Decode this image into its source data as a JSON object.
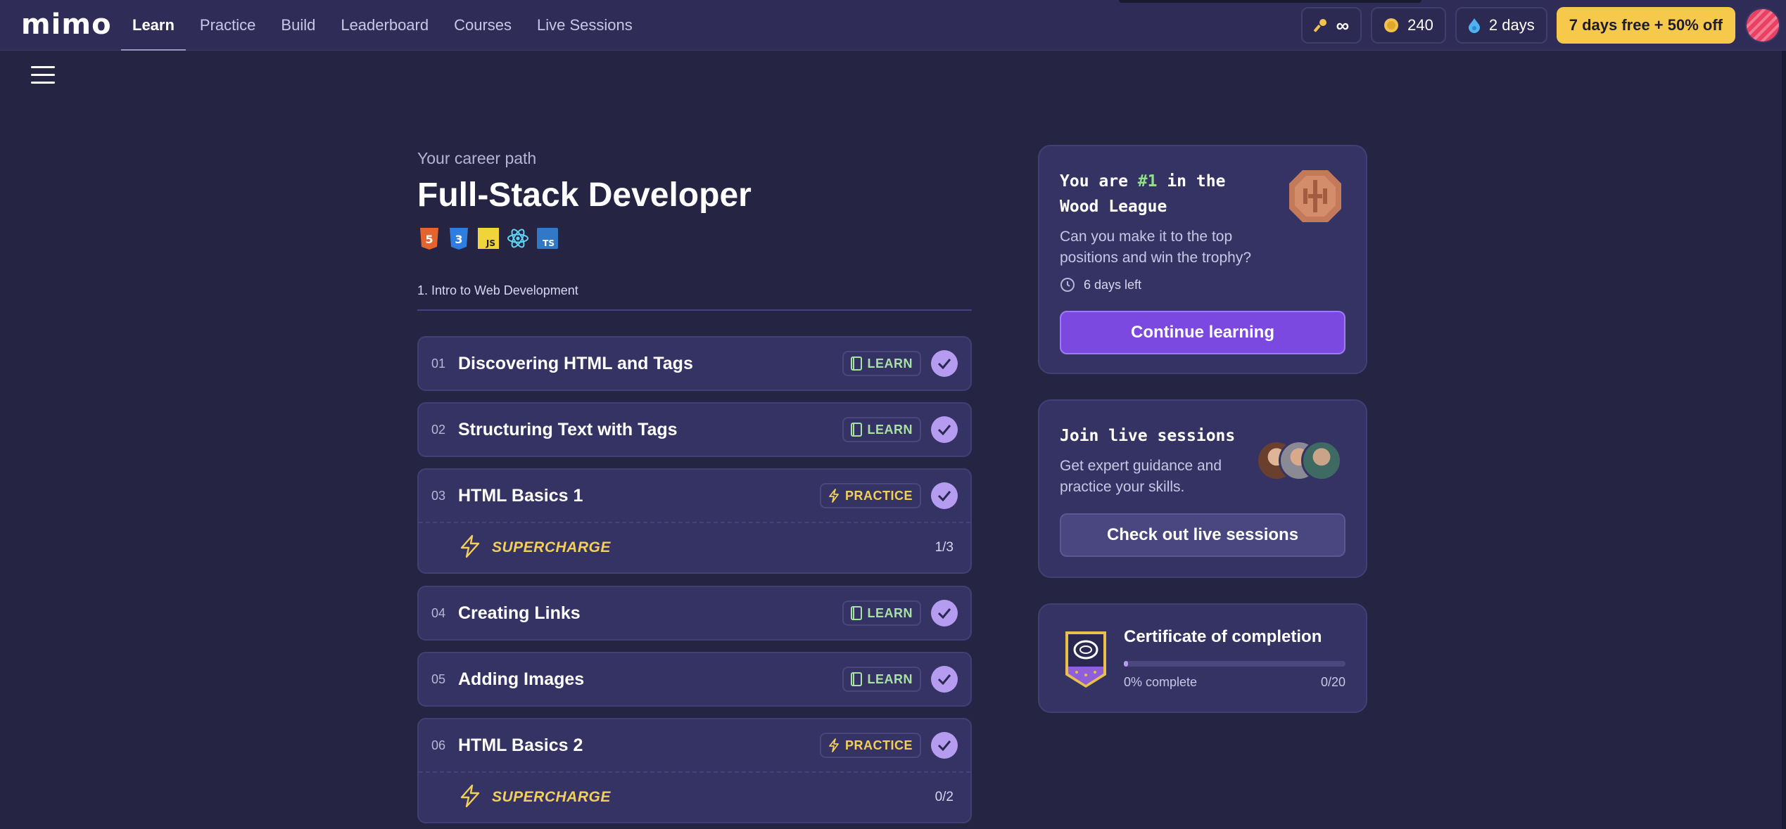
{
  "app": {
    "logo": "mimo"
  },
  "nav": {
    "items": [
      {
        "label": "Learn",
        "active": true
      },
      {
        "label": "Practice"
      },
      {
        "label": "Build"
      },
      {
        "label": "Leaderboard"
      },
      {
        "label": "Courses"
      },
      {
        "label": "Live Sessions"
      }
    ]
  },
  "header": {
    "keys_value": "∞",
    "coins_value": "240",
    "streak_value": "2 days",
    "promo_label": "7 days free + 50% off"
  },
  "career": {
    "label": "Your career path",
    "title": "Full-Stack Developer",
    "tech_icons": [
      "html5-icon",
      "css3-icon",
      "javascript-icon",
      "react-icon",
      "typescript-icon"
    ],
    "section_title": "1. Intro to Web Development"
  },
  "lessons": [
    {
      "num": "01",
      "title": "Discovering HTML and Tags",
      "tag": "LEARN"
    },
    {
      "num": "02",
      "title": "Structuring Text with Tags",
      "tag": "LEARN"
    },
    {
      "num": "03",
      "title": "HTML Basics 1",
      "tag": "PRACTICE",
      "supercharge": {
        "label": "SUPERCHARGE",
        "count": "1/3"
      }
    },
    {
      "num": "04",
      "title": "Creating Links",
      "tag": "LEARN"
    },
    {
      "num": "05",
      "title": "Adding Images",
      "tag": "LEARN"
    },
    {
      "num": "06",
      "title": "HTML Basics 2",
      "tag": "PRACTICE",
      "supercharge": {
        "label": "SUPERCHARGE",
        "count": "0/2"
      }
    }
  ],
  "league": {
    "heading_prefix": "You are ",
    "heading_rank": "#1",
    "heading_suffix": " in the Wood League",
    "text": "Can you make it to the top positions and win the trophy?",
    "time_left": "6 days left",
    "button": "Continue learning"
  },
  "live": {
    "heading": "Join live sessions",
    "text": "Get expert guidance and practice your skills.",
    "button": "Check out live sessions"
  },
  "certificate": {
    "heading": "Certificate of completion",
    "percent_label": "0% complete",
    "count": "0/20",
    "progress": 0.02
  },
  "colors": {
    "accent": "#7b48e0",
    "check": "#b59cf1",
    "promo": "#f7c94a",
    "learn": "#a7e2a3",
    "practice": "#f2cf5b"
  }
}
